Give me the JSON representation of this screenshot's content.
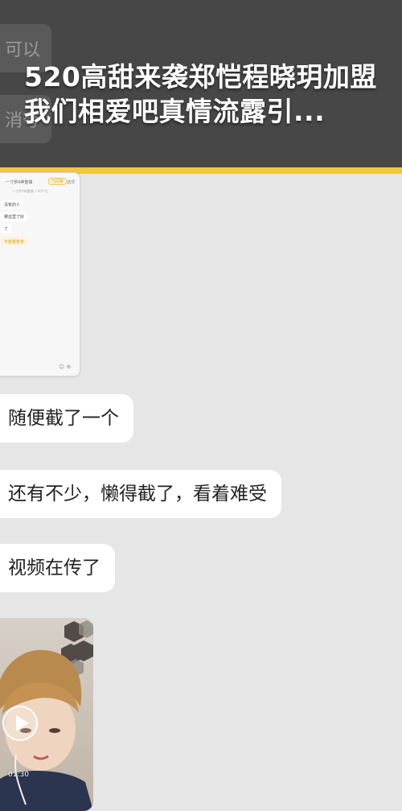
{
  "header": {
    "title": "520高甜来袭郑恺程晓玥加盟我们相爱吧真情流露引...",
    "bg_bubble_1": "可以",
    "bg_bubble_2": "消夸"
  },
  "screenshot_thumb": {
    "title": "一寸罗A神重镇",
    "badge": "已回复",
    "action": "选项",
    "subtitle": "一寸罗A神重镇 1.00个位",
    "messages": [
      "没有的人",
      "哪这里了好",
      "了",
      "不能答复未"
    ]
  },
  "messages": [
    {
      "text": "随便截了一个"
    },
    {
      "text": "还有不少，懒得截了，看着难受"
    },
    {
      "text": "视频在传了"
    }
  ],
  "video": {
    "duration": "01:30"
  },
  "colors": {
    "header_bg": "#474747",
    "accent": "#f3c736",
    "chat_bg": "#e6e6e6",
    "bubble_bg": "#ffffff"
  }
}
